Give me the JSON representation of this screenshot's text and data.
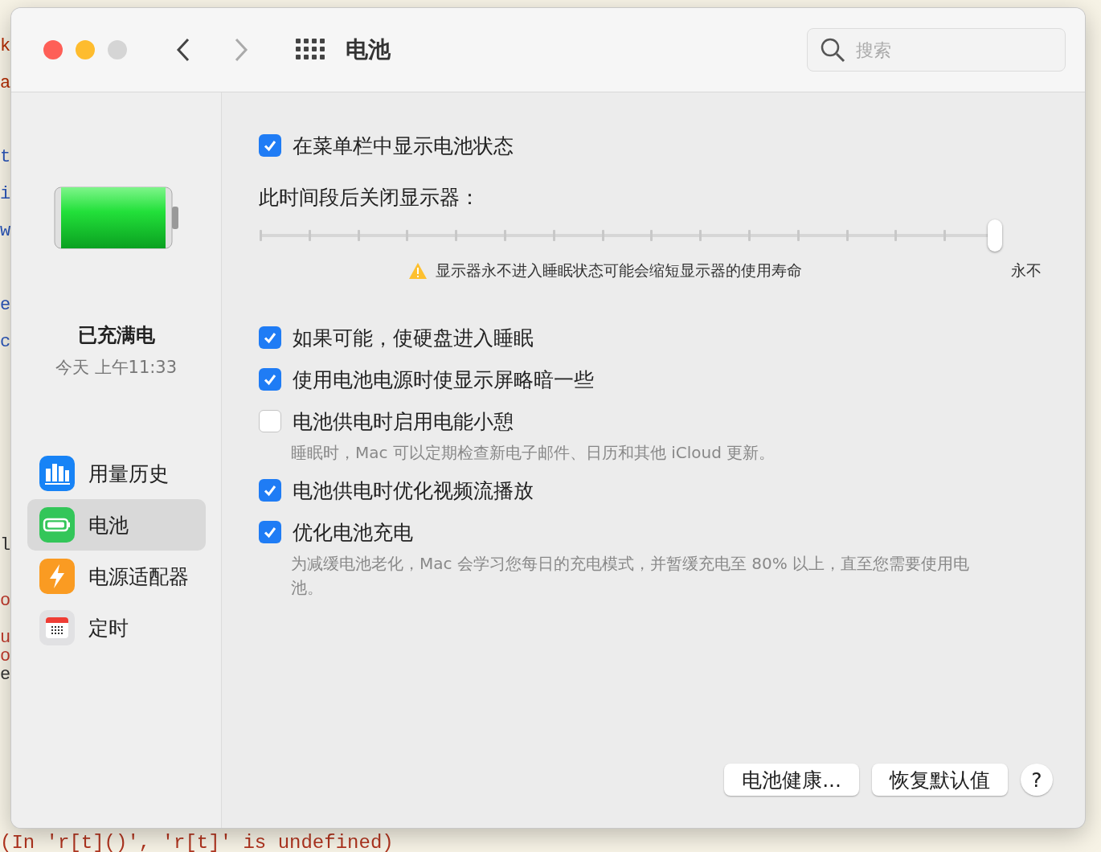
{
  "background_editor": {
    "fragments": [
      {
        "text": "k",
        "kind": "keyword"
      },
      {
        "text": "a",
        "kind": "keyword"
      },
      {
        "text": "t",
        "kind": "identifier"
      },
      {
        "text": "i",
        "kind": "identifier"
      },
      {
        "text": "w",
        "kind": "identifier"
      },
      {
        "text": "e",
        "kind": "identifier"
      },
      {
        "text": "c",
        "kind": "identifier"
      },
      {
        "text": "l",
        "kind": "plain"
      },
      {
        "text": "o",
        "kind": "string"
      },
      {
        "text": "u",
        "kind": "string"
      },
      {
        "text": "o",
        "kind": "string"
      },
      {
        "text": "e",
        "kind": "plain"
      }
    ],
    "error_line": "(In 'r[t]()', 'r[t]' is undefined)"
  },
  "window": {
    "title": "电池",
    "search": {
      "placeholder": "搜索"
    }
  },
  "sidebar": {
    "status": "已充满电",
    "time": "今天 上午11:33",
    "items": [
      {
        "label": "用量历史",
        "kind": "usage",
        "selected": false
      },
      {
        "label": "电池",
        "kind": "battery",
        "selected": true
      },
      {
        "label": "电源适配器",
        "kind": "adapter",
        "selected": false
      },
      {
        "label": "定时",
        "kind": "schedule",
        "selected": false
      }
    ]
  },
  "settings": [
    {
      "kind": "checkbox",
      "label": "在菜单栏中显示电池状态",
      "checked": true
    },
    {
      "kind": "slider",
      "label": "此时间段后关闭显示器：",
      "level": 1,
      "warning": "显示器永不进入睡眠状态可能会缩短显示器的使用寿命",
      "end_label": "永不"
    },
    {
      "kind": "checkbox",
      "label": "如果可能，使硬盘进入睡眠",
      "checked": true
    },
    {
      "kind": "checkbox",
      "label": "使用电池电源时使显示屏略暗一些",
      "checked": true
    },
    {
      "kind": "checkbox",
      "label": "电池供电时启用电能小憩",
      "checked": false,
      "note": "睡眠时，Mac 可以定期检查新电子邮件、日历和其他 iCloud 更新。"
    },
    {
      "kind": "checkbox",
      "label": "电池供电时优化视频流播放",
      "checked": true
    },
    {
      "kind": "checkbox",
      "label": "优化电池充电",
      "checked": true,
      "note": "为减缓电池老化，Mac 会学习您每日的充电模式，并暂缓充电至 80% 以上，直至您需要使用电池。"
    }
  ],
  "buttons": [
    {
      "label": "电池健康..."
    },
    {
      "label": "恢复默认值"
    },
    {
      "label": "?"
    }
  ]
}
